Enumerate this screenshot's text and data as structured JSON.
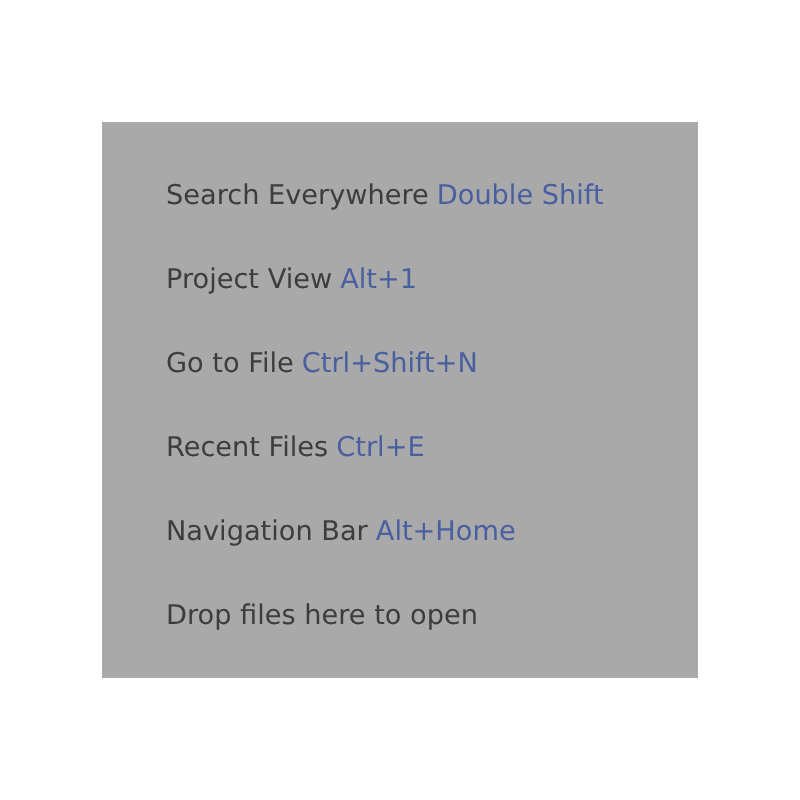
{
  "hints": [
    {
      "label": "Search Everywhere",
      "shortcut": "Double Shift"
    },
    {
      "label": "Project View",
      "shortcut": "Alt+1"
    },
    {
      "label": "Go to File",
      "shortcut": "Ctrl+Shift+N"
    },
    {
      "label": "Recent Files",
      "shortcut": "Ctrl+E"
    },
    {
      "label": "Navigation Bar",
      "shortcut": "Alt+Home"
    },
    {
      "label": "Drop files here to open"
    }
  ]
}
